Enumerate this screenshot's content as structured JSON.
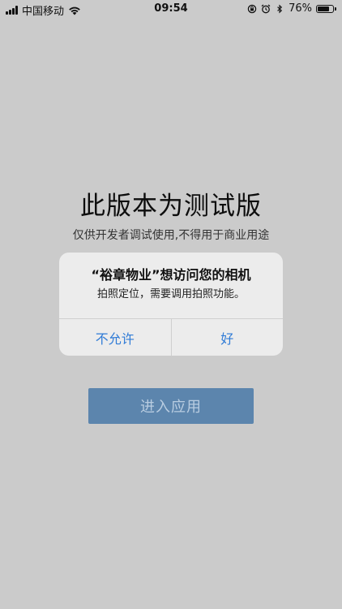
{
  "status_bar": {
    "carrier": "中国移动",
    "time": "09:54",
    "battery_percent": "76%",
    "battery_level": 0.76,
    "icons": [
      "signal-icon",
      "wifi-icon",
      "rotation-lock-icon",
      "alarm-icon",
      "bluetooth-icon",
      "battery-icon"
    ]
  },
  "main": {
    "title": "此版本为测试版",
    "subtitle": "仅供开发者调试使用,不得用于商业用途",
    "enter_button": "进入应用"
  },
  "alert": {
    "title": "“裕章物业”想访问您的相机",
    "message": "拍照定位，需要调用拍照功能。",
    "deny_button": "不允许",
    "allow_button": "好",
    "button_color": "#2f7bd6"
  },
  "colors": {
    "background": "#cbcbcb",
    "enter_button_bg": "#5c85ad",
    "enter_button_text": "#b9cde1"
  }
}
